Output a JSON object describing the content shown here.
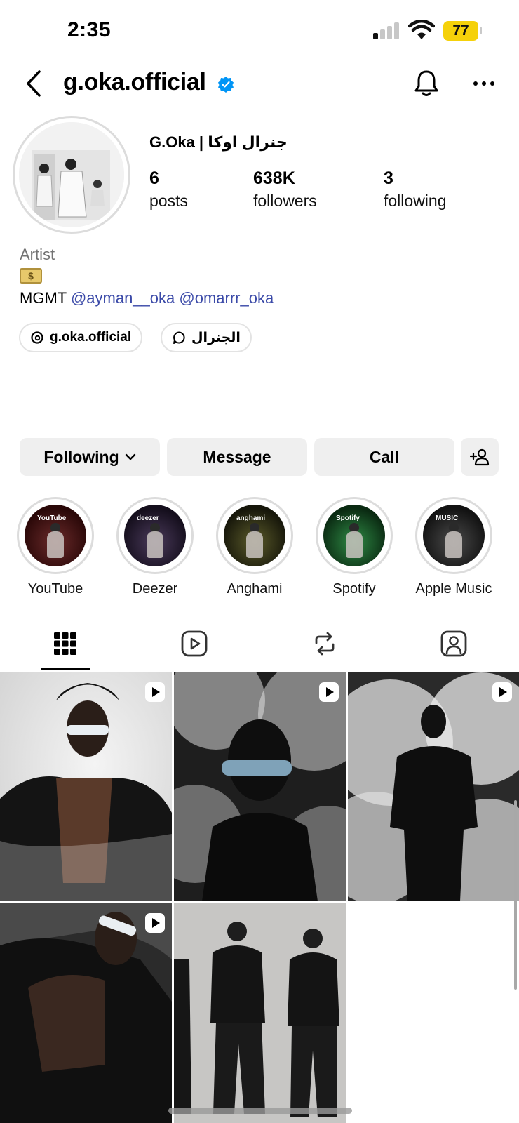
{
  "status_bar": {
    "time": "2:35",
    "battery": "77"
  },
  "header": {
    "username": "g.oka.official",
    "verified": true
  },
  "profile": {
    "display_name": "G.Oka | جنرال اوكا",
    "stats": [
      {
        "value": "6",
        "label": "posts"
      },
      {
        "value": "638K",
        "label": "followers"
      },
      {
        "value": "3",
        "label": "following"
      }
    ]
  },
  "bio": {
    "category": "Artist",
    "emoji": "$",
    "mgmt": "MGMT",
    "mention1": "@ayman__oka",
    "mention2": "@omarrr_oka"
  },
  "links": [
    {
      "label": "g.oka.official",
      "icon": "threads-icon"
    },
    {
      "label": "الجنرال",
      "icon": "messenger-icon"
    }
  ],
  "actions": {
    "following": "Following",
    "message": "Message",
    "call": "Call"
  },
  "highlights": [
    {
      "label": "YouTube",
      "brand": "YouTube",
      "color": "#3a1010"
    },
    {
      "label": "Deezer",
      "brand": "deezer",
      "color": "#231a30"
    },
    {
      "label": "Anghami",
      "brand": "anghami",
      "color": "#2c2c12"
    },
    {
      "label": "Spotify",
      "brand": "Spotify",
      "color": "#0f3a18"
    },
    {
      "label": "Apple Music",
      "brand": "MUSIC",
      "color": "#1c1c1c"
    }
  ],
  "tabs": [
    "grid-icon",
    "reels-icon",
    "reposts-icon",
    "tagged-icon"
  ]
}
